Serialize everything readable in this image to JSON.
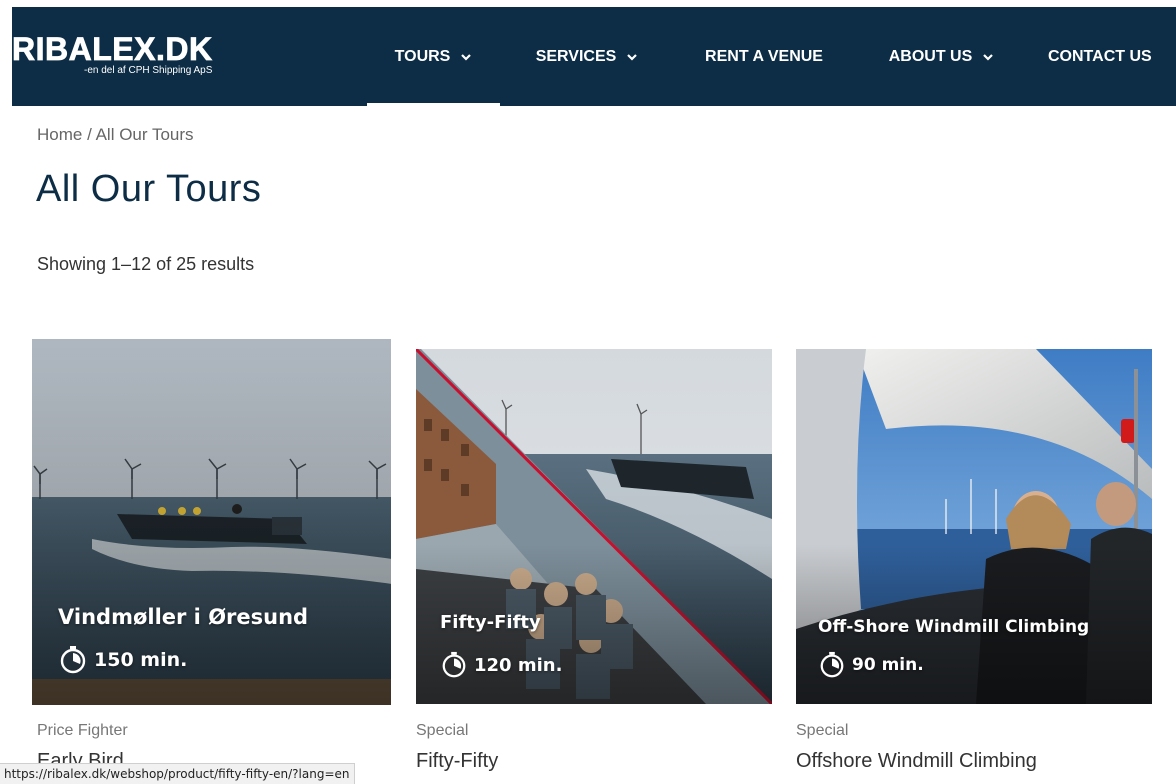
{
  "header": {
    "logo_main": "RIBALEX.DK",
    "logo_sub": "-en del af CPH Shipping ApS",
    "nav": [
      {
        "label": "TOURS",
        "has_dropdown": true,
        "active": true
      },
      {
        "label": "SERVICES",
        "has_dropdown": true
      },
      {
        "label": "RENT A VENUE",
        "has_dropdown": false
      },
      {
        "label": "ABOUT US",
        "has_dropdown": true
      },
      {
        "label": "CONTACT US",
        "has_dropdown": false
      }
    ]
  },
  "breadcrumb": {
    "home": "Home",
    "separator": " / ",
    "current": "All Our Tours"
  },
  "page_title": "All Our Tours",
  "result_count": "Showing 1–12 of 25 results",
  "products": [
    {
      "overlay_title": "Vindmøller i Øresund",
      "duration": "150 min.",
      "category": "Price Fighter",
      "name": "Early Bird"
    },
    {
      "overlay_title": "Fifty-Fifty",
      "duration": "120 min.",
      "category": "Special",
      "name": "Fifty-Fifty"
    },
    {
      "overlay_title": "Off-Shore Windmill Climbing",
      "duration": "90 min.",
      "category": "Special",
      "name": "Offshore Windmill Climbing"
    }
  ],
  "status_bar": {
    "url": "https://ribalex.dk/webshop/product/fifty-fifty-en/?lang=en"
  },
  "colors": {
    "header_bg": "#0c2d45",
    "title_color": "#0c2d45",
    "accent_red": "#c8102e"
  },
  "icons": {
    "dropdown": "chevron-down-icon",
    "duration": "timer-icon"
  }
}
